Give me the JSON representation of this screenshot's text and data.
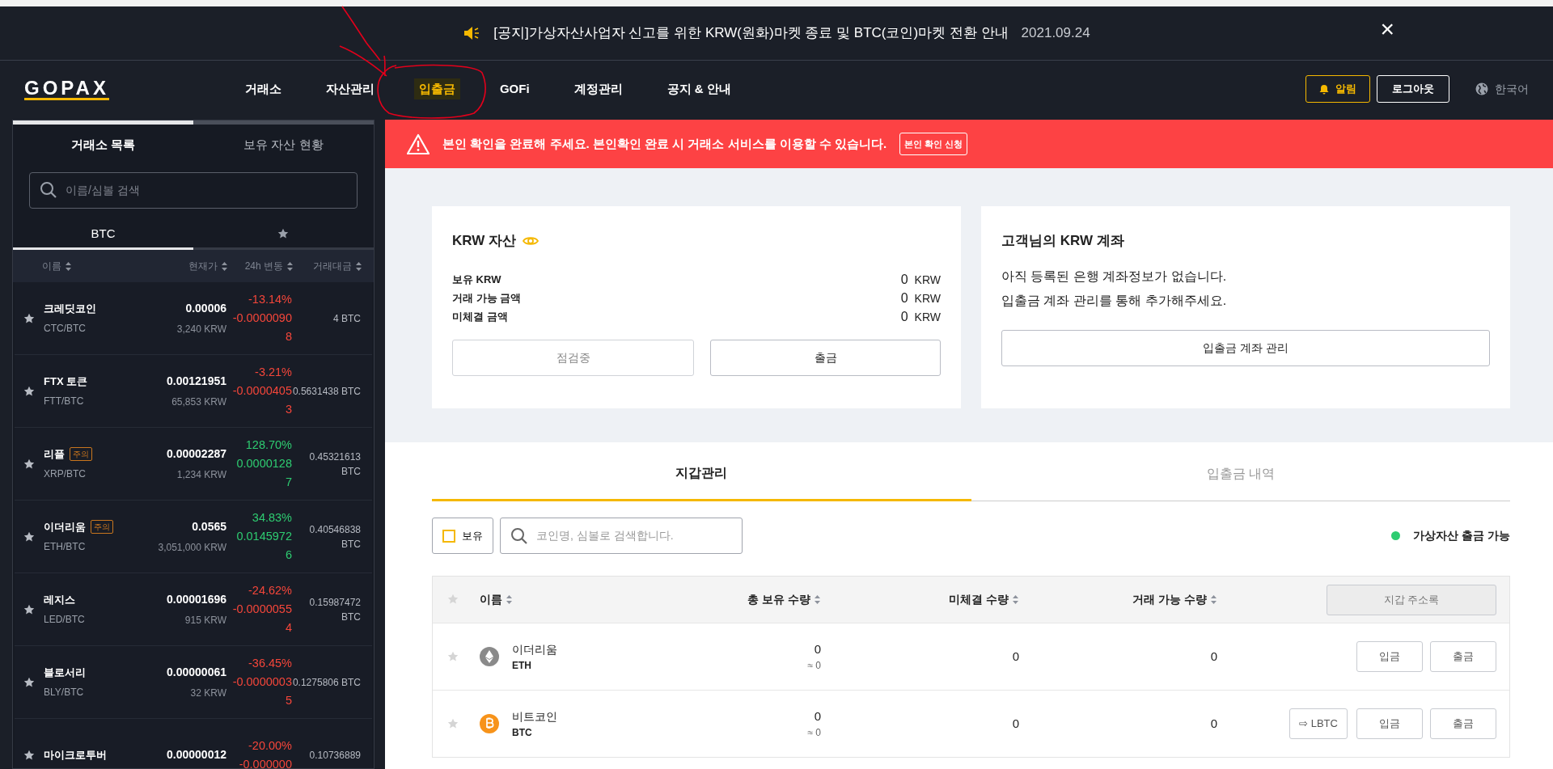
{
  "notice": {
    "text": "[공지]가상자산사업자 신고를 위한 KRW(원화)마켓 종료 및 BTC(코인)마켓 전환 안내",
    "date": "2021.09.24",
    "close": "×"
  },
  "nav": {
    "logo": "GOPAX",
    "items": [
      {
        "label": "거래소",
        "selected": false
      },
      {
        "label": "자산관리",
        "selected": false
      },
      {
        "label": "입출금",
        "selected": true
      },
      {
        "label": "GOFi",
        "selected": false
      },
      {
        "label": "계정관리",
        "selected": false
      },
      {
        "label": "공지 & 안내",
        "selected": false
      }
    ],
    "alert_button": "알림",
    "logout_button": "로그아웃",
    "language": "한국어"
  },
  "sidebar": {
    "tabs": [
      {
        "label": "거래소 목록",
        "selected": true
      },
      {
        "label": "보유 자산 현황",
        "selected": false
      }
    ],
    "search": {
      "placeholder": "이름/심볼 검색"
    },
    "market_tabs": [
      {
        "kind": "text",
        "label": "BTC",
        "selected": true
      },
      {
        "kind": "favorites",
        "selected": false
      }
    ],
    "columns": [
      "이름",
      "현재가",
      "24h 변동",
      "거래대금"
    ],
    "rows": [
      {
        "name": "크레딧코인",
        "pair": "CTC/BTC",
        "price": "0.00006",
        "krw": "3,240 KRW",
        "change_pct": "-13.14%",
        "change_amount": "-0.00000908",
        "kind": "down",
        "volume": "4 BTC"
      },
      {
        "name": "FTX 토큰",
        "pair": "FTT/BTC",
        "price": "0.00121951",
        "krw": "65,853 KRW",
        "change_pct": "-3.21%",
        "change_amount": "-0.00004053",
        "kind": "down",
        "volume": "0.5631438 BTC"
      },
      {
        "name": "리플",
        "badge": "주의",
        "pair": "XRP/BTC",
        "price": "0.00002287",
        "krw": "1,234 KRW",
        "change_pct": "128.70%",
        "change_amount": "0.00001287",
        "kind": "up",
        "volume": "0.45321613 BTC"
      },
      {
        "name": "이더리움",
        "badge": "주의",
        "pair": "ETH/BTC",
        "price": "0.0565",
        "krw": "3,051,000 KRW",
        "change_pct": "34.83%",
        "change_amount": "0.01459726",
        "kind": "up",
        "volume": "0.40546838 BTC"
      },
      {
        "name": "레지스",
        "pair": "LED/BTC",
        "price": "0.00001696",
        "krw": "915 KRW",
        "change_pct": "-24.62%",
        "change_amount": "-0.00000554",
        "kind": "down",
        "volume": "0.15987472 BTC"
      },
      {
        "name": "블로서리",
        "pair": "BLY/BTC",
        "price": "0.00000061",
        "krw": "32 KRW",
        "change_pct": "-36.45%",
        "change_amount": "-0.00000035",
        "kind": "down",
        "volume": "0.1275806 BTC"
      },
      {
        "name": "마이크로투버",
        "price": "0.00000012",
        "change_pct": "-20.00%",
        "change_amount": "-0.000000",
        "kind": "down",
        "volume": "0.10736889"
      }
    ]
  },
  "alert": {
    "text": "본인 확인을 완료해 주세요. 본인확인 완료 시 거래소 서비스를 이용할 수 있습니다.",
    "button": "본인 확인 신청"
  },
  "krw_card": {
    "title": "KRW 자산",
    "rows": [
      {
        "label": "보유 KRW",
        "value": "0",
        "unit": "KRW"
      },
      {
        "label": "거래 가능 금액",
        "value": "0",
        "unit": "KRW"
      },
      {
        "label": "미체결 금액",
        "value": "0",
        "unit": "KRW"
      }
    ],
    "buttons": [
      {
        "label": "점검중",
        "disabled": true
      },
      {
        "label": "출금",
        "disabled": false
      }
    ]
  },
  "account_card": {
    "title": "고객님의 KRW 계좌",
    "lines": [
      "아직 등록된 은행 계좌정보가 없습니다.",
      "입출금 계좌 관리를 통해 추가해주세요."
    ],
    "button": "입출금 계좌 관리"
  },
  "wallet": {
    "tabs": [
      {
        "label": "지갑관리",
        "selected": true
      },
      {
        "label": "입출금 내역",
        "selected": false
      }
    ],
    "holding_filter": {
      "label": "보유",
      "checked": false
    },
    "search": {
      "placeholder": "코인명, 심볼로 검색합니다."
    },
    "status": "가상자산 출금 가능",
    "columns": [
      "이름",
      "총 보유 수량",
      "미체결 수량",
      "거래 가능 수량"
    ],
    "address_book": "지갑 주소록",
    "rows": [
      {
        "kind": "eth",
        "name": "이더리움",
        "symbol": "ETH",
        "total": "0",
        "approx": "≈ 0",
        "pending": "0",
        "available": "0",
        "actions": [
          "입금",
          "출금"
        ]
      },
      {
        "kind": "btc",
        "name": "비트코인",
        "symbol": "BTC",
        "total": "0",
        "approx": "≈ 0",
        "pending": "0",
        "available": "0",
        "convert": "⇨ LBTC",
        "actions": [
          "입금",
          "출금"
        ]
      }
    ]
  }
}
